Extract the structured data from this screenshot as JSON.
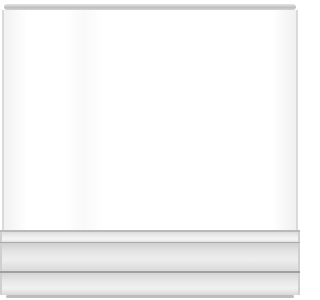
{
  "product": {
    "type_icon": "air-conditioner-indoor-unit",
    "colors": {
      "panel": "#ffffff",
      "trim": "#bdbdbd",
      "louver": "#e4e4e4"
    }
  }
}
